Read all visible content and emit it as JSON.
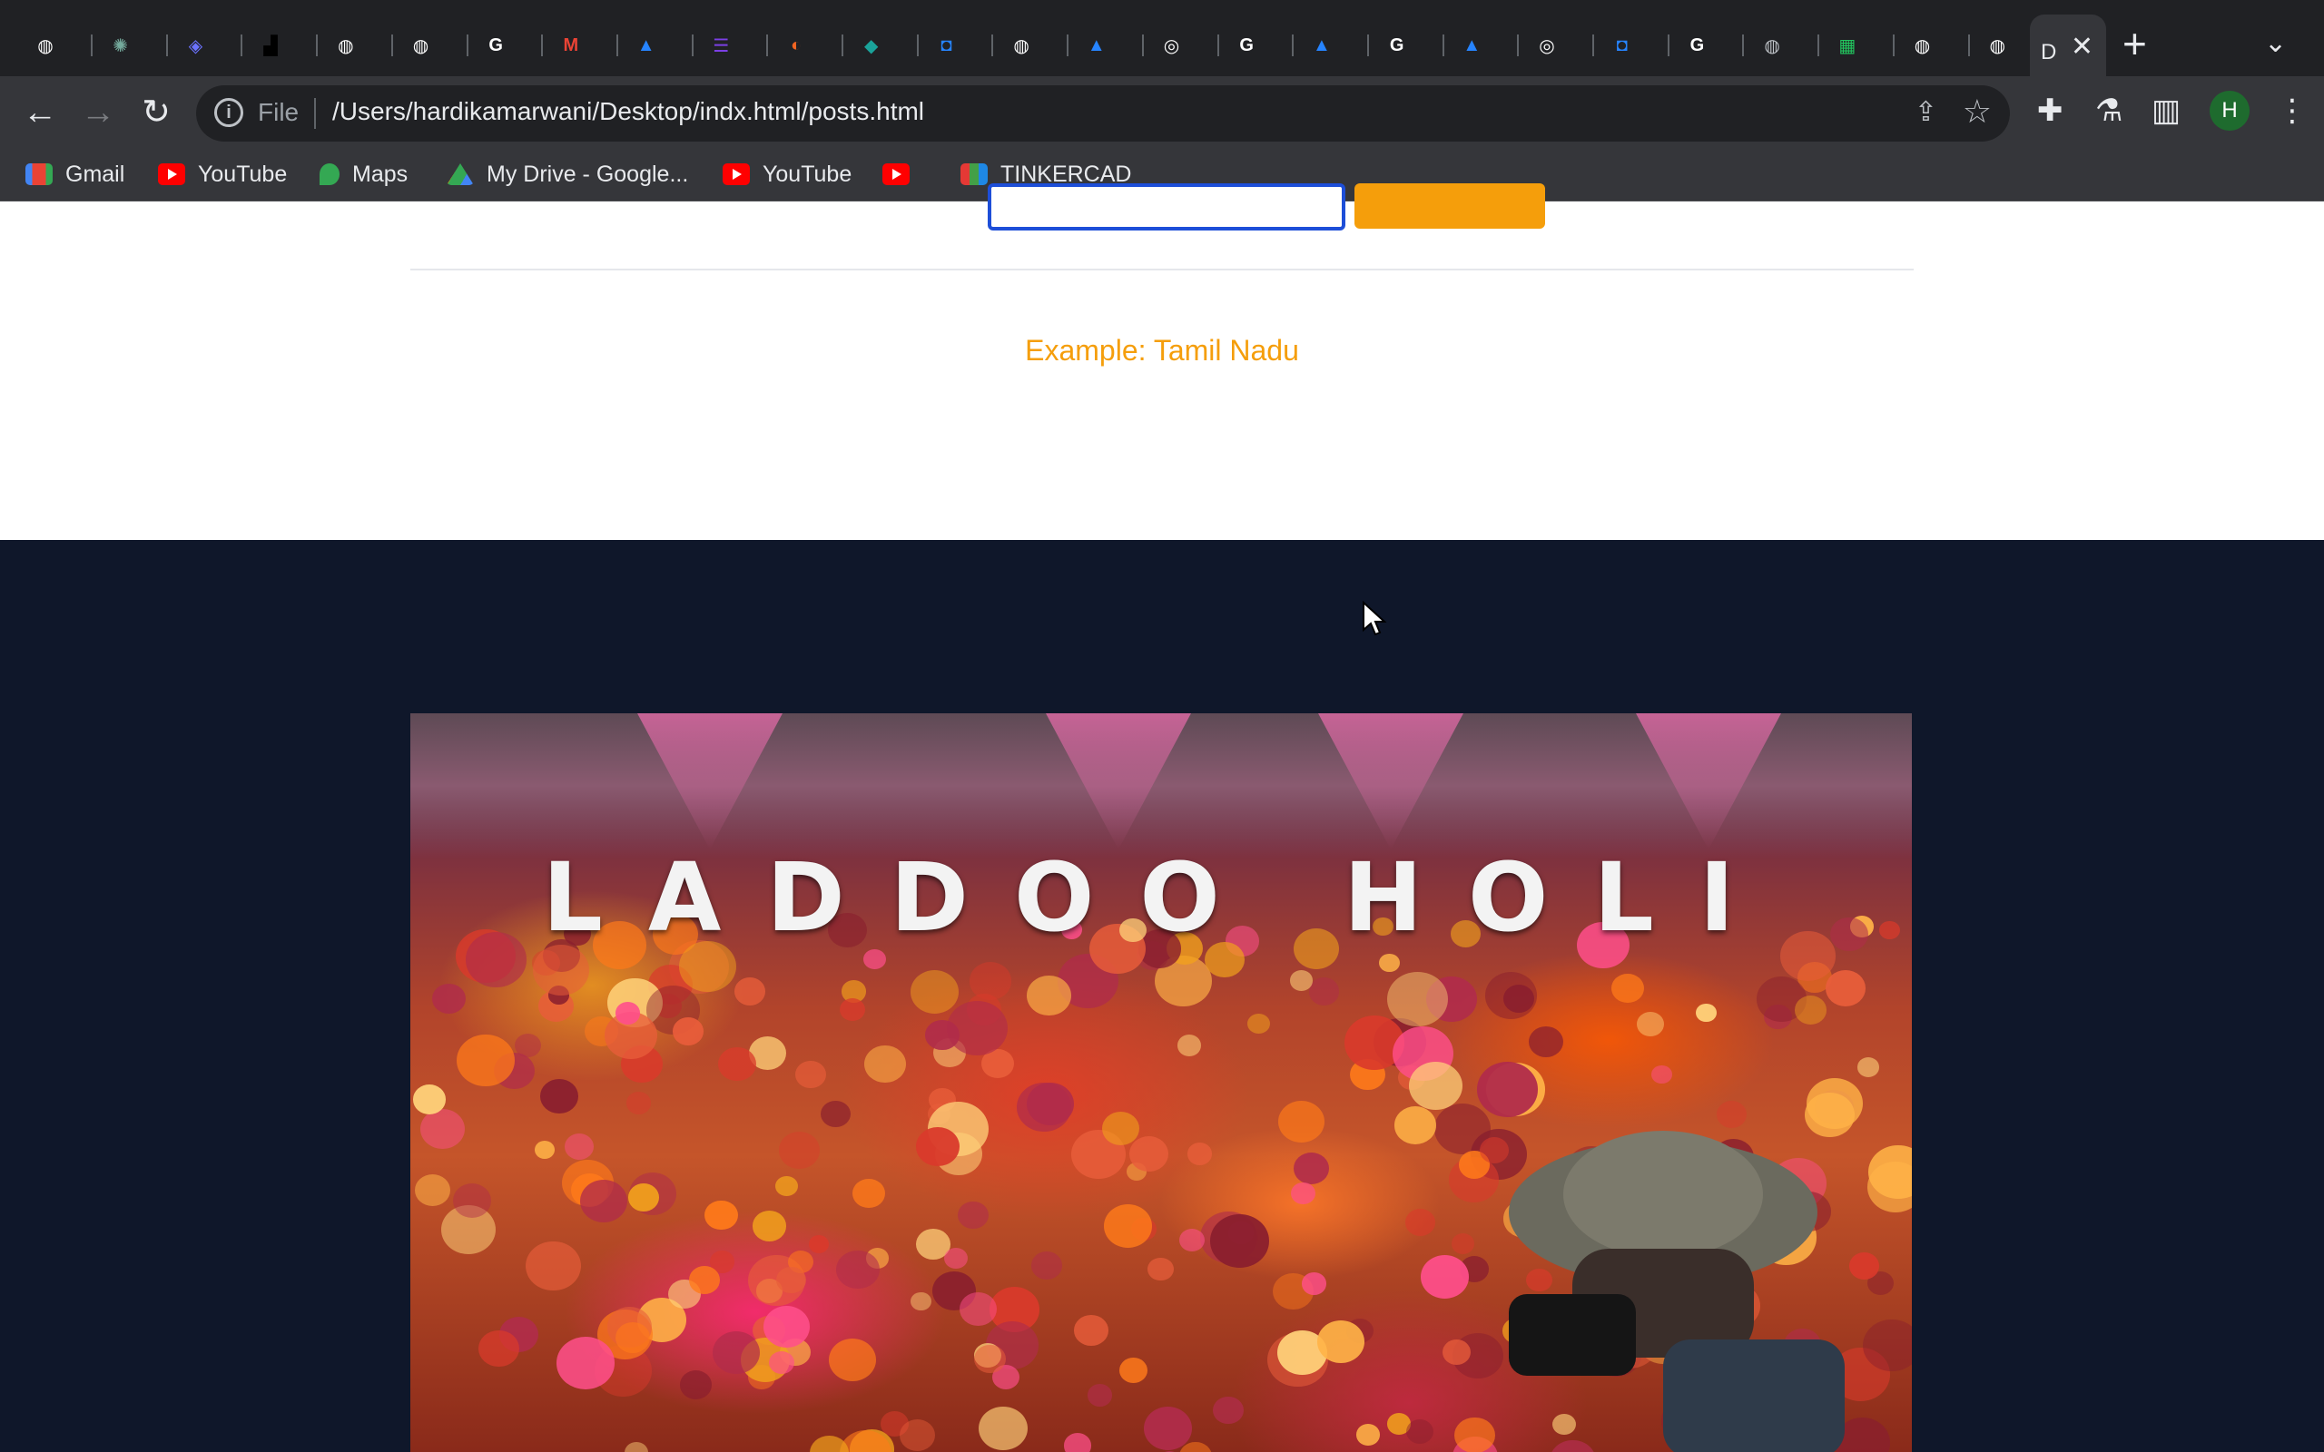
{
  "browser": {
    "tabs": [
      {
        "icon": "globe-icon",
        "color": "#ffffff"
      },
      {
        "icon": "chatgpt-icon",
        "color": "#74aa9c"
      },
      {
        "icon": "stack-icon",
        "color": "#6b72ff"
      },
      {
        "icon": "unsplash-icon",
        "color": "#000000"
      },
      {
        "icon": "globe-icon",
        "color": "#ffffff"
      },
      {
        "icon": "globe-icon",
        "color": "#ffffff"
      },
      {
        "icon": "google-icon",
        "color": "#ffffff"
      },
      {
        "icon": "gmail-icon",
        "color": "#ea4335"
      },
      {
        "icon": "atlassian-icon",
        "color": "#2684ff"
      },
      {
        "icon": "list-icon",
        "color": "#7b3fe4"
      },
      {
        "icon": "eclipse-icon",
        "color": "#f26522"
      },
      {
        "icon": "diamond-icon",
        "color": "#1aa39a"
      },
      {
        "icon": "bitbucket-icon",
        "color": "#2684ff"
      },
      {
        "icon": "globe-icon",
        "color": "#ffffff"
      },
      {
        "icon": "atlassian-icon",
        "color": "#2684ff"
      },
      {
        "icon": "chrome-icon",
        "color": "#ffffff"
      },
      {
        "icon": "google-icon",
        "color": "#ffffff"
      },
      {
        "icon": "atlassian-icon",
        "color": "#2684ff"
      },
      {
        "icon": "google-icon",
        "color": "#ffffff"
      },
      {
        "icon": "atlassian-icon",
        "color": "#2684ff"
      },
      {
        "icon": "chrome-icon",
        "color": "#ffffff"
      },
      {
        "icon": "bitbucket-icon",
        "color": "#2684ff"
      },
      {
        "icon": "google-icon",
        "color": "#ffffff"
      },
      {
        "icon": "globe-icon",
        "color": "#bdc1c6"
      },
      {
        "icon": "sheets-icon",
        "color": "#22c55e"
      },
      {
        "icon": "globe-icon",
        "color": "#ffffff"
      },
      {
        "icon": "globe-icon",
        "color": "#ffffff"
      }
    ],
    "active_tab_title": "D",
    "omnibox": {
      "scheme_label": "File",
      "url": "/Users/hardikamarwani/Desktop/indx.html/posts.html"
    },
    "avatar_letter": "H",
    "bookmarks": [
      {
        "label": "Gmail",
        "icon": "gmail-icon"
      },
      {
        "label": "YouTube",
        "icon": "youtube-icon"
      },
      {
        "label": "Maps",
        "icon": "maps-icon"
      },
      {
        "label": "My Drive - Google...",
        "icon": "drive-icon"
      },
      {
        "label": "YouTube",
        "icon": "youtube-icon"
      },
      {
        "label": "",
        "icon": "youtube-icon"
      },
      {
        "label": "TINKERCAD",
        "icon": "tinkercad-icon"
      }
    ]
  },
  "page": {
    "example_text": "Example: Tamil Nadu",
    "hero_title": "LADDOO HOLI",
    "colors": {
      "accent": "#f59e0b",
      "input_border": "#1d4ed8",
      "dark_bg": "#0f172a"
    }
  }
}
